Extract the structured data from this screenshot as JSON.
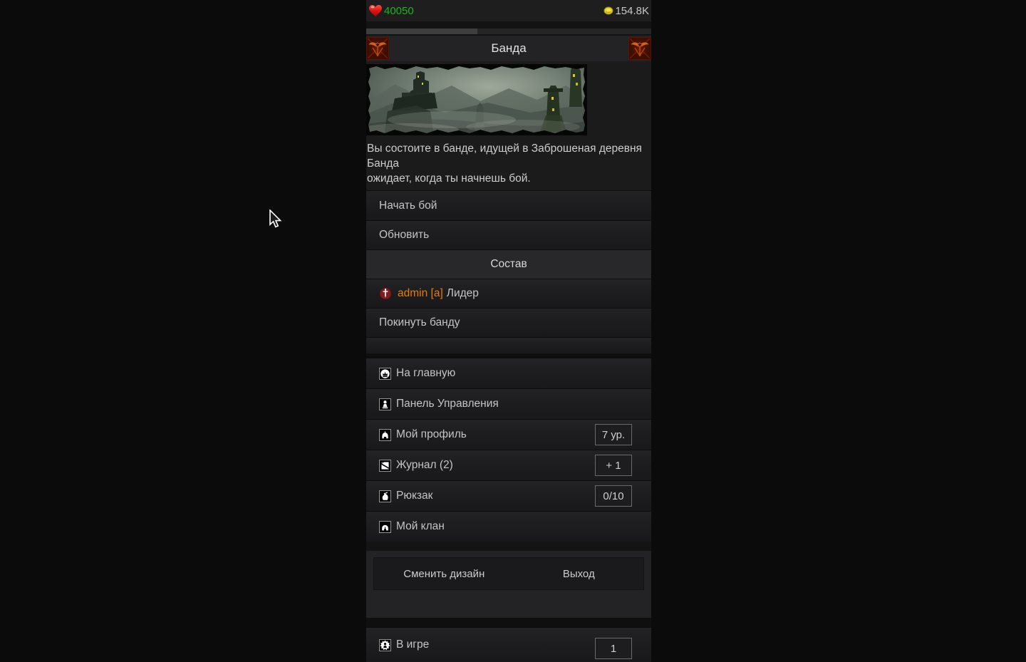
{
  "topbar": {
    "health": "40050",
    "money": "154.8K"
  },
  "progress": {
    "percent": 39
  },
  "header": {
    "title": "Банда"
  },
  "gang": {
    "description_lines": [
      "Вы состоите в банде, идущей в Заброшеная деревня Банда",
      "ожидает, когда ты начнешь бой."
    ],
    "actions": [
      {
        "label": "Начать бой"
      },
      {
        "label": "Обновить"
      }
    ],
    "section_title": "Состав",
    "members": [
      {
        "name": "admin [a]",
        "role": "Лидер"
      }
    ],
    "leave_label": "Покинуть банду"
  },
  "menu": {
    "items": [
      {
        "icon": "home-icon",
        "label": "На главную",
        "badge": ""
      },
      {
        "icon": "control-panel-icon",
        "label": "Панель Управления",
        "badge": ""
      },
      {
        "icon": "profile-helmet-icon",
        "label": "Мой профиль",
        "badge": "7 ур."
      },
      {
        "icon": "journal-scroll-icon",
        "label": "Журнал (2)",
        "badge": "+ 1"
      },
      {
        "icon": "backpack-sack-icon",
        "label": "Рюкзак",
        "badge": "0/10"
      },
      {
        "icon": "clan-helmet-icon",
        "label": "Мой клан",
        "badge": ""
      }
    ]
  },
  "footer": {
    "change_design": "Сменить дизайн",
    "exit": "Выход"
  },
  "online": {
    "label": "В игре",
    "count": "1"
  },
  "colors": {
    "health_green": "#1db41d",
    "coin_yellow": "#e3cf1e",
    "member_orange": "#e67e00",
    "row_bg": "#1c1c1e",
    "accent_emblem": "#c8500f"
  }
}
